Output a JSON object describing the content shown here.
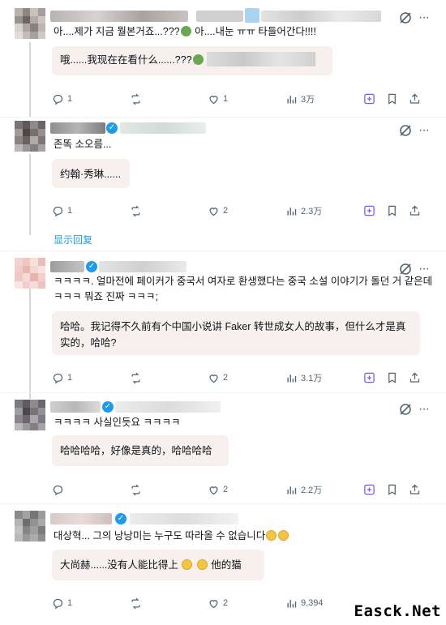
{
  "tweets": [
    {
      "text": "아....제가 지금 뭘본거죠...???",
      "text_tail": " 아....내눈 ㅠㅠ 타들어간다!!!!",
      "translation": "哦......我现在在看什么......???",
      "stats": {
        "reply": "1",
        "retweet": "",
        "like": "1",
        "views": "3万"
      }
    },
    {
      "text": "존똑 소오름...",
      "translation": "约翰·秀琳......",
      "stats": {
        "reply": "1",
        "retweet": "",
        "like": "2",
        "views": "2.3万"
      },
      "show_replies": "显示回复"
    },
    {
      "text": "ㅋㅋㅋㅋ. 얼마전에 페이커가 중국서 여자로 환생했다는 중국 소설 이야기가 돌던 거 같은데 ㅋㅋㅋ 뭐죠 진짜 ㅋㅋㅋ;",
      "translation": "哈哈。我记得不久前有个中国小说讲 Faker 转世成女人的故事，但什么才是真实的，哈哈?",
      "stats": {
        "reply": "1",
        "retweet": "",
        "like": "2",
        "views": "3.1万"
      }
    },
    {
      "text": "ㅋㅋㅋㅋ 사실인듯요 ㅋㅋㅋㅋ",
      "translation": "哈哈哈哈，好像是真的，哈哈哈哈",
      "stats": {
        "reply": "",
        "retweet": "",
        "like": "2",
        "views": "2.2万"
      }
    },
    {
      "text": "대상혁... 그의 낭낭미는 누구도 따라올 수 없습니다",
      "translation_a": "大尚赫......没有人能比得上",
      "translation_b": "他的猫",
      "stats": {
        "reply": "1",
        "retweet": "",
        "like": "2",
        "views": "9,394"
      }
    }
  ],
  "icons": {
    "reply": "reply-icon",
    "retweet": "retweet-icon",
    "like": "heart-icon",
    "views": "views-icon",
    "grok": "grok-icon",
    "bookmark": "bookmark-icon",
    "share": "share-icon",
    "more": "more-icon"
  },
  "colors": {
    "accent": "#1d9bf0",
    "muted": "#536471",
    "grok_purple": "#7856ff",
    "translation_bg": "#f7f0ee"
  },
  "watermark": "Easck.Net"
}
